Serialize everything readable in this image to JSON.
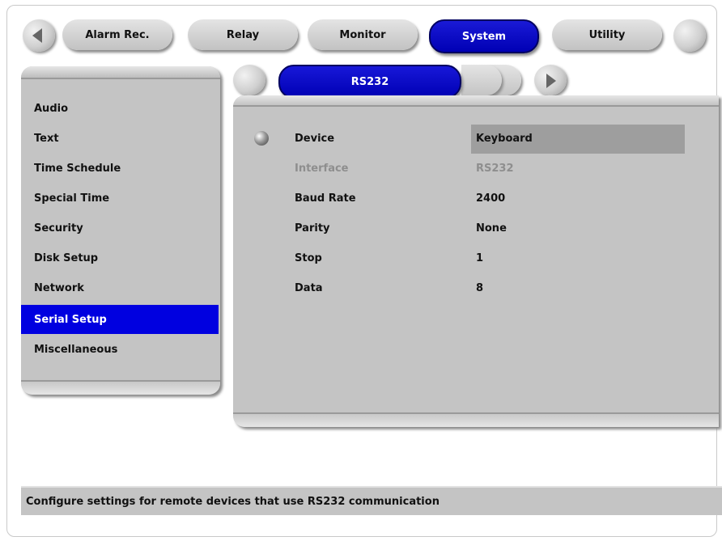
{
  "top_tabs": [
    "Alarm Rec.",
    "Relay",
    "Monitor",
    "System",
    "Utility"
  ],
  "active_top_tab": "System",
  "menu": {
    "items": [
      "Audio",
      "Text",
      "Time Schedule",
      "Special Time",
      "Security",
      "Disk Setup",
      "Network",
      "Serial Setup",
      "Miscellaneous"
    ],
    "selected": "Serial Setup"
  },
  "sub_tab": {
    "label": "RS232"
  },
  "settings": {
    "device": {
      "label": "Device",
      "value": "Keyboard"
    },
    "interface": {
      "label": "Interface",
      "value": "RS232",
      "disabled": true
    },
    "baud_rate": {
      "label": "Baud Rate",
      "value": "2400"
    },
    "parity": {
      "label": "Parity",
      "value": "None"
    },
    "stop": {
      "label": "Stop",
      "value": "1"
    },
    "data": {
      "label": "Data",
      "value": "8"
    }
  },
  "status_message": "Configure settings for remote devices that use RS232 communication",
  "colors": {
    "accent_blue": "#0000e0",
    "panel_gray": "#c4c4c4",
    "highlight_gray": "#9e9e9e",
    "disabled_text": "#8e8e8e"
  }
}
